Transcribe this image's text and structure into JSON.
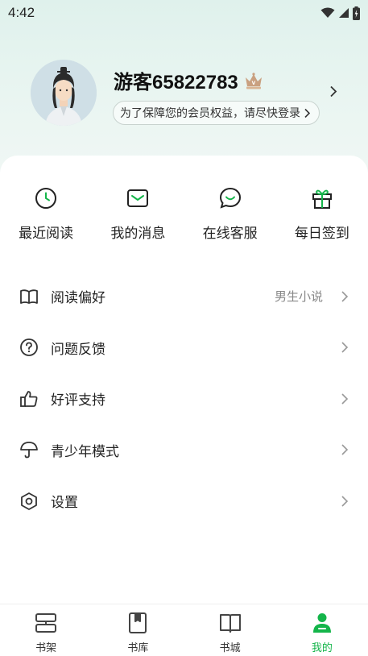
{
  "status_bar": {
    "time": "4:42"
  },
  "profile": {
    "username": "游客65822783",
    "login_tip": "为了保障您的会员权益，请尽快登录"
  },
  "quick_actions": [
    {
      "label": "最近阅读",
      "icon": "clock-icon"
    },
    {
      "label": "我的消息",
      "icon": "message-icon"
    },
    {
      "label": "在线客服",
      "icon": "chat-icon"
    },
    {
      "label": "每日签到",
      "icon": "gift-icon"
    }
  ],
  "menu": [
    {
      "label": "阅读偏好",
      "value": "男生小说",
      "icon": "book-open-icon"
    },
    {
      "label": "问题反馈",
      "value": "",
      "icon": "question-icon"
    },
    {
      "label": "好评支持",
      "value": "",
      "icon": "thumb-up-icon"
    },
    {
      "label": "青少年模式",
      "value": "",
      "icon": "umbrella-icon"
    },
    {
      "label": "设置",
      "value": "",
      "icon": "settings-icon"
    }
  ],
  "tabbar": {
    "active_index": 3,
    "tabs": [
      {
        "label": "书架",
        "icon": "bookshelf-icon"
      },
      {
        "label": "书库",
        "icon": "library-icon"
      },
      {
        "label": "书城",
        "icon": "bookstore-icon"
      },
      {
        "label": "我的",
        "icon": "profile-icon"
      }
    ]
  },
  "colors": {
    "accent": "#14b54a",
    "header_bg": "#e3f3ee",
    "text_primary": "#222222",
    "text_secondary": "#888888"
  }
}
